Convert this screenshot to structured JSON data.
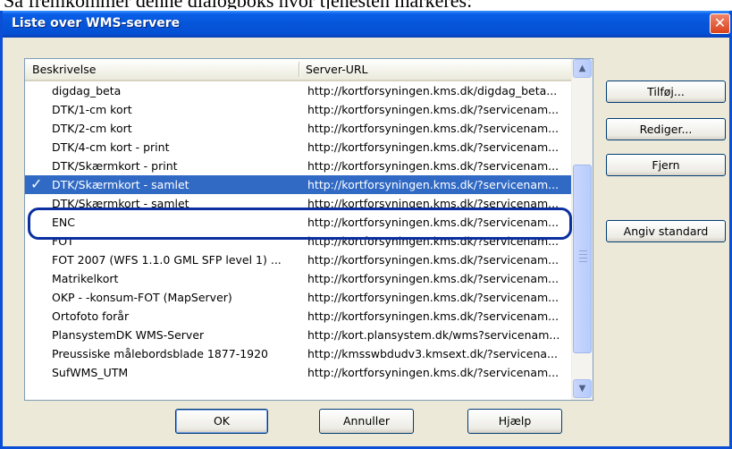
{
  "background_caption": "Så fremkommer denne dialogboks hvor tjenesten markeres:",
  "window": {
    "title": "Liste over WMS-servere",
    "close_glyph": "✕"
  },
  "list": {
    "columns": [
      "Beskrivelse",
      "Server-URL"
    ],
    "check_glyph": "✓",
    "selected_index": 5,
    "rows": [
      {
        "description": "digdag_beta",
        "url": "http://kortforsyningen.kms.dk/digdag_beta..."
      },
      {
        "description": "DTK/1-cm kort",
        "url": "http://kortforsyningen.kms.dk/?servicenam..."
      },
      {
        "description": "DTK/2-cm kort",
        "url": "http://kortforsyningen.kms.dk/?servicenam..."
      },
      {
        "description": "DTK/4-cm kort - print",
        "url": "http://kortforsyningen.kms.dk/?servicenam..."
      },
      {
        "description": "DTK/Skærmkort - print",
        "url": "http://kortforsyningen.kms.dk/?servicenam..."
      },
      {
        "description": "DTK/Skærmkort - samlet",
        "url": "http://kortforsyningen.kms.dk/?servicenam..."
      },
      {
        "description": "DTK/Skærmkort - samlet",
        "url": "http://kortforsyningen.kms.dk/?servicenam..."
      },
      {
        "description": "ENC",
        "url": "http://kortforsyningen.kms.dk/?servicenam..."
      },
      {
        "description": "FOT",
        "url": "http://kortforsyningen.kms.dk/?servicenam..."
      },
      {
        "description": "FOT 2007 (WFS 1.1.0 GML SFP level 1) ...",
        "url": "http://kortforsyningen.kms.dk/?servicenam..."
      },
      {
        "description": "Matrikelkort",
        "url": "http://kortforsyningen.kms.dk/?servicenam..."
      },
      {
        "description": "OKP - -konsum-FOT (MapServer)",
        "url": "http://kortforsyningen.kms.dk/?servicenam..."
      },
      {
        "description": "Ortofoto forår",
        "url": "http://kortforsyningen.kms.dk/?servicenam..."
      },
      {
        "description": "PlansystemDK WMS-Server",
        "url": "http://kort.plansystem.dk/wms?servicenam..."
      },
      {
        "description": "Preussiske målebordsblade 1877-1920",
        "url": "http://kmsswbdudv3.kmsext.dk/?servicena..."
      },
      {
        "description": "SufWMS_UTM",
        "url": "http://kortforsyningen.kms.dk/?servicenam..."
      }
    ]
  },
  "scrollbar": {
    "up_glyph": "▲",
    "down_glyph": "▼"
  },
  "side_buttons": {
    "add": "Tilføj...",
    "edit": "Rediger...",
    "remove": "Fjern",
    "set_default": "Angiv standard"
  },
  "bottom_buttons": {
    "ok": "OK",
    "cancel": "Annuller",
    "help": "Hjælp"
  },
  "colors": {
    "titlebar": "#0655d8",
    "selection": "#316ac5",
    "highlight_ring": "#0b2fa0",
    "dialog_face": "#ece9d8",
    "close_button": "#d9411a"
  }
}
